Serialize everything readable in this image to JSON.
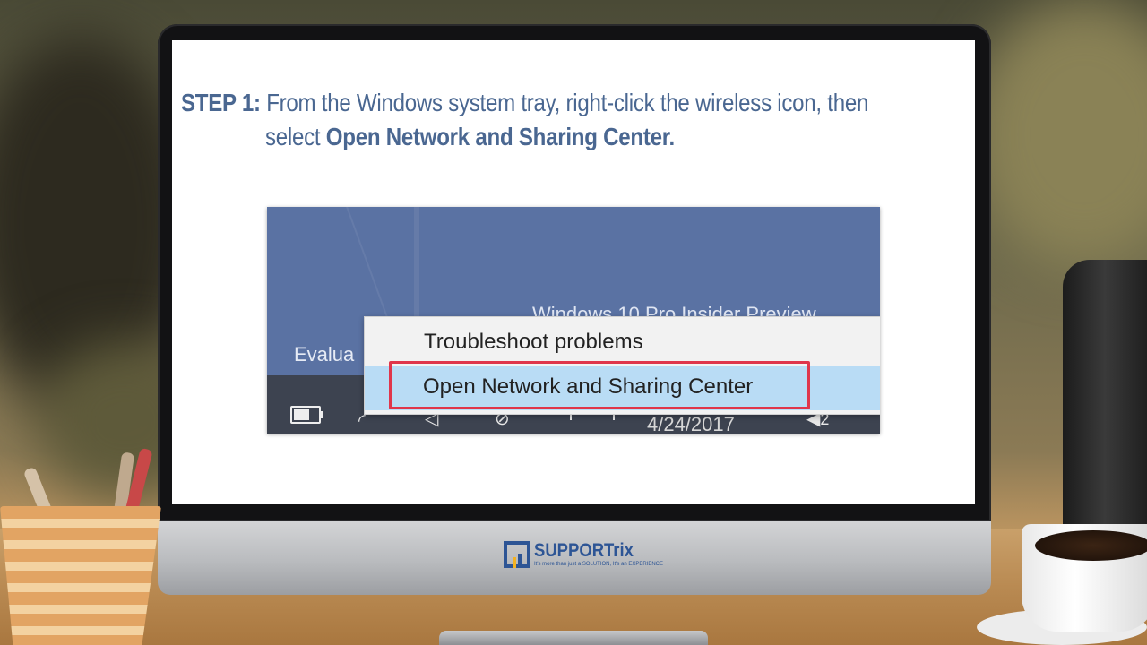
{
  "slide": {
    "step_label": "STEP 1:",
    "line1_text": "From the Windows system tray, right-click the wireless icon, then",
    "line2_prefix": "select ",
    "line2_bold": "Open Network and Sharing Center."
  },
  "screenshot": {
    "watermark": "Windows 10 Pro Insider Preview",
    "evaluation_text": "Evalua",
    "context_menu": {
      "items": [
        {
          "label": "Troubleshoot problems"
        },
        {
          "label": "Open Network and Sharing Center",
          "highlighted": true
        }
      ]
    },
    "taskbar": {
      "date": "4/24/2017",
      "notification_count": "2",
      "icons": [
        "battery-icon",
        "wifi-icon",
        "volume-icon",
        "pen-icon",
        "keyboard-icon",
        "notification-icon"
      ]
    }
  },
  "branding": {
    "logo_name": "SUPPORTrix",
    "logo_tagline": "It's more than just a SOLUTION, It's an EXPERIENCE"
  },
  "colors": {
    "step_text": "#4a6791",
    "highlight_border": "#e0364b",
    "menu_selected_bg": "#b9dcf5",
    "logo_blue": "#2d5595",
    "logo_accent": "#f3b221"
  }
}
